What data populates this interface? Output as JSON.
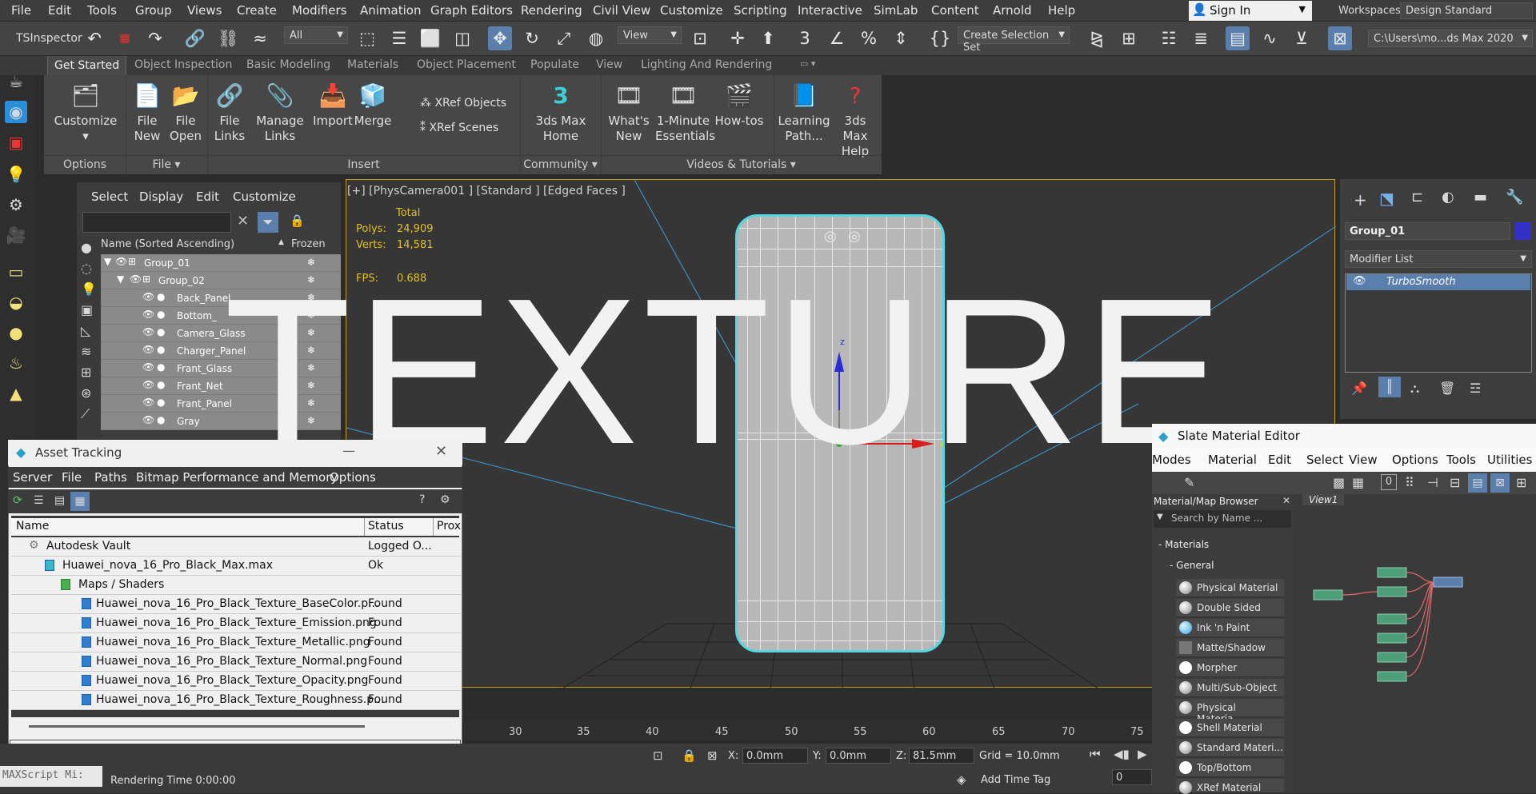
{
  "menubar": {
    "items": [
      "File",
      "Edit",
      "Tools",
      "Group",
      "Views",
      "Create",
      "Modifiers",
      "Animation",
      "Graph Editors",
      "Rendering",
      "Civil View",
      "Customize",
      "Scripting",
      "Interactive",
      "SimLab",
      "Content",
      "Arnold",
      "Help"
    ],
    "sign_in": "Sign In",
    "workspaces_label": "Workspaces:",
    "workspace_value": "Design Standard"
  },
  "toolbar": {
    "tsinspector": "TSInspector",
    "filter_select": "All",
    "view_select": "View",
    "selection_set": "Create Selection Set",
    "project_path": "C:\\Users\\mo...ds Max 2020"
  },
  "ribbon": {
    "tabs": [
      "Get Started",
      "Object Inspection",
      "Basic Modeling",
      "Materials",
      "Object Placement",
      "Populate",
      "View",
      "Lighting And Rendering"
    ],
    "buttons": {
      "customize": "Customize",
      "file_new": "File New",
      "file_open": "File Open",
      "file_links": "File Links",
      "manage_links": "Manage Links",
      "import": "Import",
      "merge": "Merge",
      "xref_objects": "XRef Objects",
      "xref_scenes": "XRef Scenes",
      "max_home": "3ds Max Home",
      "whats_new": "What's New",
      "one_minute": "1-Minute Essentials",
      "howtos": "How-tos",
      "learning_path": "Learning Path...",
      "max_help": "3ds Max Help"
    },
    "groups": {
      "options": "Options",
      "file": "File",
      "insert": "Insert",
      "community": "Community",
      "videos": "Videos & Tutorials"
    }
  },
  "explorer": {
    "menu": [
      "Select",
      "Display",
      "Edit",
      "Customize"
    ],
    "col_name": "Name (Sorted Ascending)",
    "col_frozen": "Frozen",
    "rows": [
      "Group_01",
      "Group_02",
      "Back_Panel",
      "Bottom_",
      "Camera_Glass",
      "Charger_Panel",
      "Frant_Glass",
      "Frant_Net",
      "Frant_Panel",
      "Gray"
    ]
  },
  "viewport": {
    "label": "[+] [PhysCamera001 ] [Standard ] [Edged Faces ]",
    "total_label": "Total",
    "polys_label": "Polys:",
    "polys_value": "24,909",
    "verts_label": "Verts:",
    "verts_value": "14,581",
    "fps_label": "FPS:",
    "fps_value": "0.688",
    "watermark": "TEXTURE"
  },
  "command_panel": {
    "object_name": "Group_01",
    "modifier_list": "Modifier List",
    "modifier": "TurboSmooth",
    "color": "#3431c8"
  },
  "slate": {
    "title": "Slate Material Editor",
    "menu": [
      "Modes",
      "Material",
      "Edit",
      "Select",
      "View",
      "Options",
      "Tools",
      "Utilities"
    ],
    "browser_title": "Material/Map Browser",
    "search_placeholder": "Search by Name ...",
    "materials_header": "Materials",
    "general_header": "General",
    "view_tab": "View1",
    "zero_badge": "0",
    "materials": [
      "Physical Material",
      "Double Sided",
      "Ink 'n Paint",
      "Matte/Shadow",
      "Morpher",
      "Multi/Sub-Object",
      "Physical Materia...",
      "Shell Material",
      "Standard Materi...",
      "Top/Bottom",
      "XRef Material"
    ]
  },
  "asset": {
    "title": "Asset Tracking",
    "menu": [
      "Server",
      "File",
      "Paths",
      "Bitmap Performance and Memory",
      "Options"
    ],
    "col_name": "Name",
    "col_status": "Status",
    "col_proxy": "Prox",
    "rows": [
      {
        "name": "Autodesk Vault",
        "status": "Logged O..."
      },
      {
        "name": "Huawei_nova_16_Pro_Black_Max.max",
        "status": "Ok"
      },
      {
        "name": "Maps / Shaders",
        "status": ""
      },
      {
        "name": "Huawei_nova_16_Pro_Black_Texture_BaseColor.p...",
        "status": "Found"
      },
      {
        "name": "Huawei_nova_16_Pro_Black_Texture_Emission.png",
        "status": "Found"
      },
      {
        "name": "Huawei_nova_16_Pro_Black_Texture_Metallic.png",
        "status": "Found"
      },
      {
        "name": "Huawei_nova_16_Pro_Black_Texture_Normal.png",
        "status": "Found"
      },
      {
        "name": "Huawei_nova_16_Pro_Black_Texture_Opacity.png",
        "status": "Found"
      },
      {
        "name": "Huawei_nova_16_Pro_Black_Texture_Roughness.p...",
        "status": "Found"
      }
    ]
  },
  "timeline": {
    "ticks": [
      "30",
      "35",
      "40",
      "45",
      "50",
      "55",
      "60",
      "65",
      "70",
      "75"
    ]
  },
  "status": {
    "maxscript": "MAXScript Mi:",
    "rendering_time": "Rendering Time  0:00:00",
    "x_label": "X:",
    "x_value": "0.0mm",
    "y_label": "Y:",
    "y_value": "0.0mm",
    "z_label": "Z:",
    "z_value": "81.5mm",
    "grid": "Grid = 10.0mm",
    "add_time_tag": "Add Time Tag",
    "frame_value": "0"
  }
}
